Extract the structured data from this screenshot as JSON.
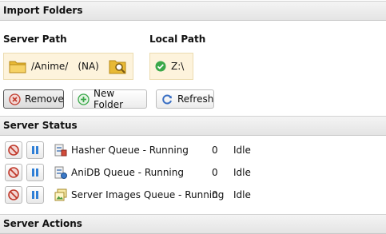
{
  "import_folders": {
    "title": "Import Folders",
    "server_path_label": "Server Path",
    "local_path_label": "Local Path",
    "server_path_value": "/Anime/",
    "server_path_note": "(NA)",
    "local_path_value": "Z:\\",
    "buttons": {
      "remove": "Remove",
      "new_folder": "New Folder",
      "refresh": "Refresh"
    }
  },
  "server_status": {
    "title": "Server Status",
    "queues": [
      {
        "name": "Hasher Queue - Running",
        "count": "0",
        "state": "Idle",
        "icon": "hasher-queue-icon"
      },
      {
        "name": "AniDB Queue - Running",
        "count": "0",
        "state": "Idle",
        "icon": "anidb-queue-icon"
      },
      {
        "name": "Server Images Queue - Running",
        "count": "0",
        "state": "Idle",
        "icon": "images-queue-icon"
      }
    ]
  },
  "server_actions": {
    "title": "Server Actions"
  },
  "colors": {
    "header_bg": "#e9e9e9",
    "path_box_bg": "#fdf3dc",
    "stop_red": "#c0392b",
    "pause_blue": "#2f7fd6",
    "ok_green": "#3aa84a"
  }
}
